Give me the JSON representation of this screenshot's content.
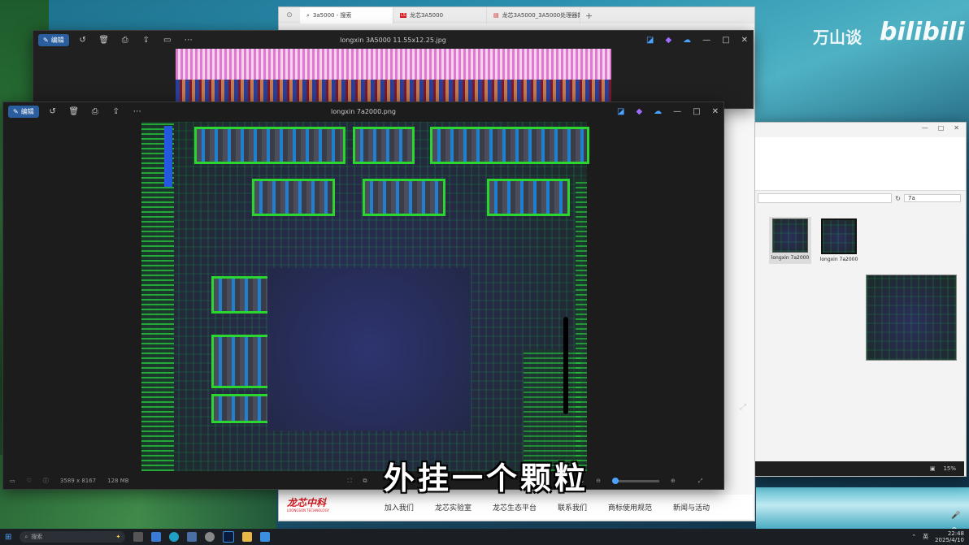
{
  "watermark": {
    "text": "万山谈",
    "brand": "bilibili"
  },
  "browser": {
    "tabs": [
      {
        "label": "3a5000 - 搜索"
      },
      {
        "label": "龙芯3A5000"
      },
      {
        "label": "龙芯3A5000_3A5000处理器数据..."
      }
    ],
    "nav_links": [
      "加入我们",
      "龙芯实验室",
      "龙芯生态平台",
      "联系我们",
      "商标使用规范",
      "新闻与活动"
    ],
    "logo_text": "龙芯中科",
    "logo_sub": "LOONGSON TECHNOLOGY"
  },
  "photo_back": {
    "title": "longxin 3A5000 11.55x12.25.jpg",
    "edit_label": "编辑"
  },
  "photo_front": {
    "title": "longxin 7a2000.png",
    "edit_label": "编辑",
    "dimensions": "3589 x 8167",
    "filesize": "128 MB",
    "zoom": "14%"
  },
  "explorer": {
    "search_value": "7a",
    "files": [
      {
        "name": "longxin 7a2000"
      },
      {
        "name": "longxin 7a2000"
      }
    ],
    "zoom": "15%"
  },
  "subtitle": "外挂一个颗粒",
  "taskbar": {
    "search_placeholder": "搜索",
    "time": "22:48",
    "date": "2025/4/10",
    "lang": "英"
  },
  "colors": {
    "accent": "#2b5e9e",
    "die_green": "#2bd62f",
    "loongson_red": "#d71920"
  }
}
